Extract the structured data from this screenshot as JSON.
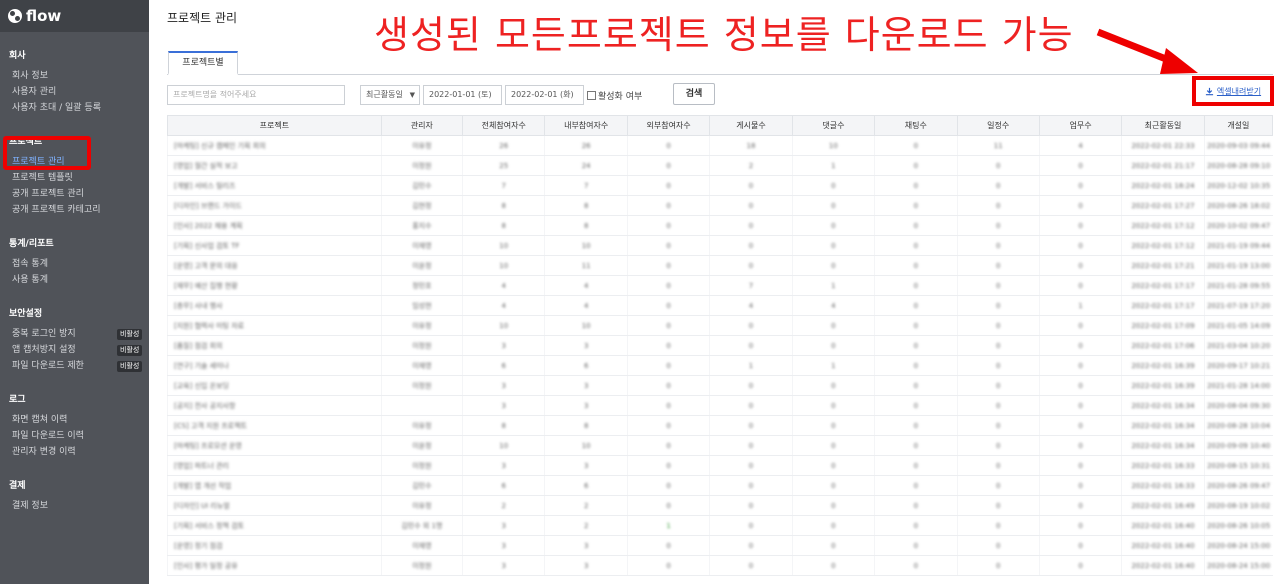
{
  "app": {
    "logo_text": "flow"
  },
  "sidebar": {
    "sections": [
      {
        "title": "회사",
        "items": [
          {
            "label": "회사 정보"
          },
          {
            "label": "사용자 관리"
          },
          {
            "label": "사용자 초대 / 일괄 등록"
          }
        ]
      },
      {
        "title": "프로젝트",
        "items": [
          {
            "label": "프로젝트 관리",
            "active": true
          },
          {
            "label": "프로젝트 템플릿"
          },
          {
            "label": "공개 프로젝트 관리"
          },
          {
            "label": "공개 프로젝트 카테고리"
          }
        ]
      },
      {
        "title": "통계/리포트",
        "items": [
          {
            "label": "접속 통계"
          },
          {
            "label": "사용 통계"
          }
        ]
      },
      {
        "title": "보안설정",
        "items": [
          {
            "label": "중복 로그인 방지",
            "badge": "비활성"
          },
          {
            "label": "앱 캡처방지 설정",
            "badge": "비활성"
          },
          {
            "label": "파일 다운로드 제한",
            "badge": "비활성"
          }
        ]
      },
      {
        "title": "로그",
        "items": [
          {
            "label": "화면 캡쳐 이력"
          },
          {
            "label": "파일 다운로드 이력"
          },
          {
            "label": "관리자 변경 이력"
          }
        ]
      },
      {
        "title": "결제",
        "items": [
          {
            "label": "결제 정보"
          }
        ]
      }
    ]
  },
  "header": {
    "title": "프로젝트 관리"
  },
  "banner": {
    "text": "생성된 모든프로젝트 정보를 다운로드 가능",
    "color": "#ee2222"
  },
  "tabs": [
    {
      "label": "프로젝트별"
    }
  ],
  "filters": {
    "search_placeholder": "프로젝트명을 적어주세요",
    "sort_value": "최근활동일",
    "start_date": "2022-01-01 (토)",
    "end_date": "2022-02-01 (화)",
    "active_label": "활성화 여부",
    "search_button": "검색"
  },
  "excel_button": {
    "label": "엑셀내려받기"
  },
  "accent": {
    "highlight": "#ee0000",
    "tab": "#3a6fd8",
    "link": "#2a5fc8"
  },
  "table": {
    "columns": [
      "프로젝트",
      "관리자",
      "전체참여자수",
      "내부참여자수",
      "외부참여자수",
      "게시물수",
      "댓글수",
      "채팅수",
      "일정수",
      "업무수",
      "최근활동일",
      "개설일"
    ],
    "rows": [
      [
        "[마케팅] 신규 캠페인 기획 회의",
        "이유정",
        "26",
        "26",
        "0",
        "18",
        "10",
        "0",
        "11",
        "4",
        "2022-02-01 22:33",
        "2020-09-03 09:44"
      ],
      [
        "[영업] 월간 실적 보고",
        "이정원",
        "25",
        "24",
        "0",
        "2",
        "1",
        "0",
        "0",
        "0",
        "2022-02-01 21:17",
        "2020-08-28 09:10"
      ],
      [
        "[개발] 서비스 릴리즈",
        "김민수",
        "7",
        "7",
        "0",
        "0",
        "0",
        "0",
        "0",
        "0",
        "2022-02-01 18:24",
        "2020-12-02 10:35"
      ],
      [
        "[디자인] 브랜드 가이드",
        "김현정",
        "8",
        "8",
        "0",
        "0",
        "0",
        "0",
        "0",
        "0",
        "2022-02-01 17:27",
        "2020-08-26 18:02"
      ],
      [
        "[인사] 2022 채용 계획",
        "홍지수",
        "8",
        "8",
        "0",
        "0",
        "0",
        "0",
        "0",
        "0",
        "2022-02-01 17:12",
        "2020-10-02 09:47"
      ],
      [
        "[기획] 신사업 검토 TF",
        "이재영",
        "10",
        "10",
        "0",
        "0",
        "0",
        "0",
        "0",
        "0",
        "2022-02-01 17:12",
        "2021-01-19 09:44"
      ],
      [
        "[운영] 고객 문의 대응",
        "이윤정",
        "10",
        "11",
        "0",
        "0",
        "0",
        "0",
        "0",
        "0",
        "2022-02-01 17:21",
        "2021-01-19 13:00"
      ],
      [
        "[재무] 예산 집행 현황",
        "정민호",
        "4",
        "4",
        "0",
        "7",
        "1",
        "0",
        "0",
        "0",
        "2022-02-01 17:17",
        "2021-01-28 09:55"
      ],
      [
        "[총무] 사내 행사",
        "임성현",
        "4",
        "4",
        "0",
        "4",
        "4",
        "0",
        "0",
        "1",
        "2022-02-01 17:17",
        "2021-07-19 17:20"
      ],
      [
        "[지원] 협력사 미팅 자료",
        "이유정",
        "10",
        "10",
        "0",
        "0",
        "0",
        "0",
        "0",
        "0",
        "2022-02-01 17:09",
        "2021-01-05 14:09"
      ],
      [
        "[품질] 점검 회의",
        "이정원",
        "3",
        "3",
        "0",
        "0",
        "0",
        "0",
        "0",
        "0",
        "2022-02-01 17:06",
        "2021-03-04 10:20"
      ],
      [
        "[연구] 기술 세미나",
        "이재영",
        "6",
        "6",
        "0",
        "1",
        "1",
        "0",
        "0",
        "0",
        "2022-02-01 16:39",
        "2020-09-17 10:21"
      ],
      [
        "[교육] 신입 온보딩",
        "이정원",
        "3",
        "3",
        "0",
        "0",
        "0",
        "0",
        "0",
        "0",
        "2022-02-01 16:39",
        "2021-01-28 14:00"
      ],
      [
        "[공지] 전사 공지사항",
        "",
        "3",
        "3",
        "0",
        "0",
        "0",
        "0",
        "0",
        "0",
        "2022-02-01 16:34",
        "2020-08-04 09:30"
      ],
      [
        "[CS] 고객 지원 프로젝트",
        "이유정",
        "8",
        "8",
        "0",
        "0",
        "0",
        "0",
        "0",
        "0",
        "2022-02-01 16:34",
        "2020-08-28 10:04"
      ],
      [
        "[마케팅] 프로모션 운영",
        "이윤정",
        "10",
        "10",
        "0",
        "0",
        "0",
        "0",
        "0",
        "0",
        "2022-02-01 16:34",
        "2020-09-09 10:40"
      ],
      [
        "[영업] 파트너 관리",
        "이정원",
        "3",
        "3",
        "0",
        "0",
        "0",
        "0",
        "0",
        "0",
        "2022-02-01 16:33",
        "2020-08-15 10:31"
      ],
      [
        "[개발] 앱 개선 작업",
        "김민수",
        "6",
        "6",
        "0",
        "0",
        "0",
        "0",
        "0",
        "0",
        "2022-02-01 16:33",
        "2020-08-26 09:47"
      ],
      [
        "[디자인] UI 리뉴얼",
        "이유정",
        "2",
        "2",
        "0",
        "0",
        "0",
        "0",
        "0",
        "0",
        "2022-02-01 16:49",
        "2020-08-19 10:02"
      ],
      [
        "[기획] 서비스 정책 검토",
        "김민수 외 1명",
        "3",
        "2",
        "1",
        "0",
        "0",
        "0",
        "0",
        "0",
        "2022-02-01 16:40",
        "2020-08-26 10:05"
      ],
      [
        "[운영] 정기 점검",
        "이재영",
        "3",
        "3",
        "0",
        "0",
        "0",
        "0",
        "0",
        "0",
        "2022-02-01 16:40",
        "2020-08-24 15:00"
      ],
      [
        "[인사] 평가 일정 공유",
        "이정원",
        "3",
        "3",
        "0",
        "0",
        "0",
        "0",
        "0",
        "0",
        "2022-02-01 16:40",
        "2020-08-24 15:00"
      ]
    ]
  }
}
